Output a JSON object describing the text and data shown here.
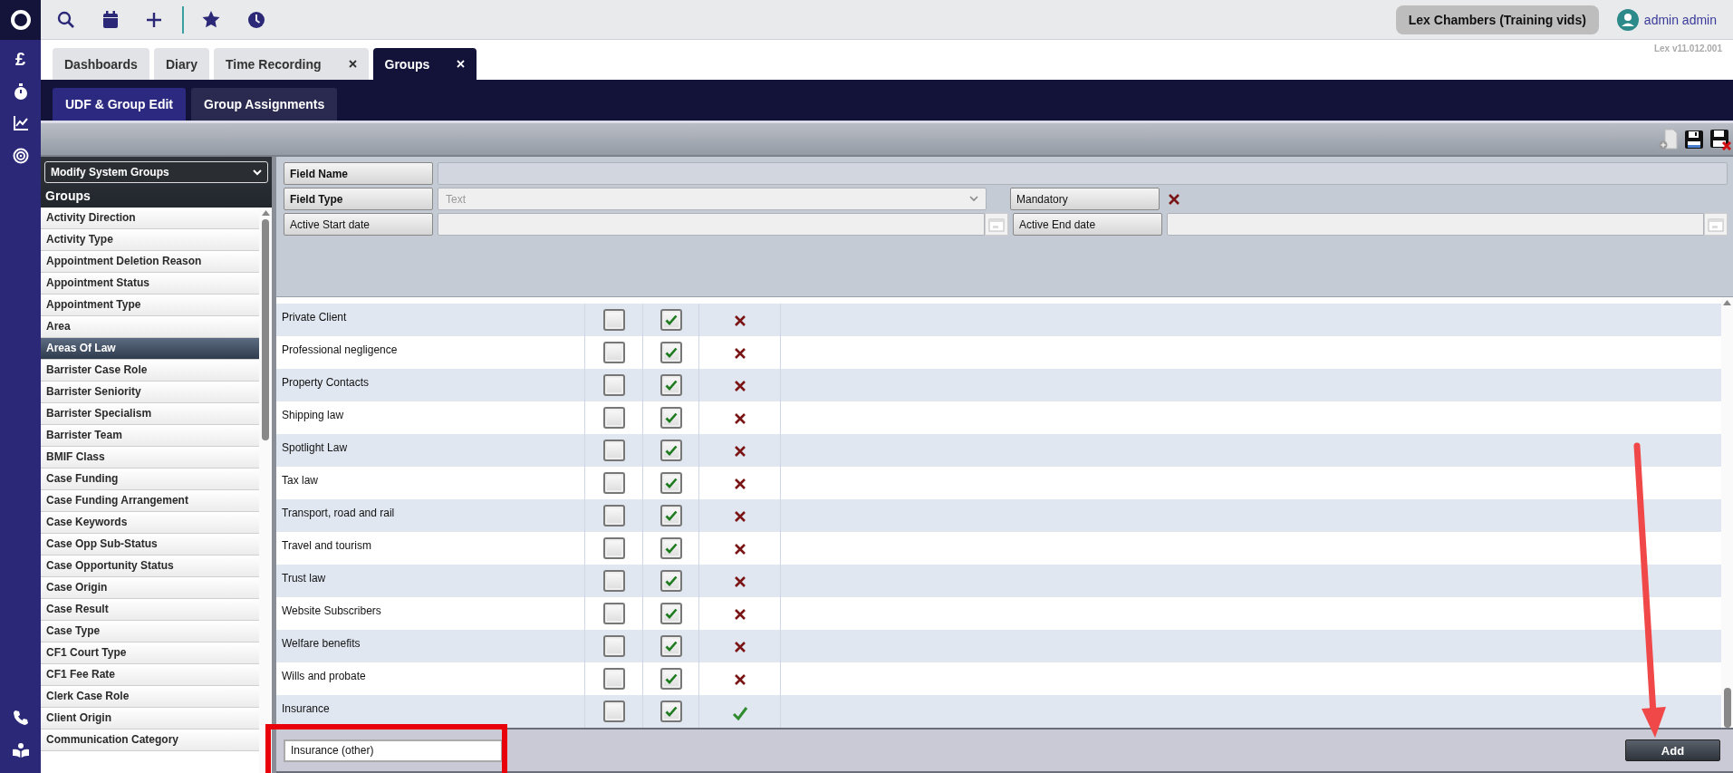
{
  "rail": {
    "currency_glyph": "£"
  },
  "topbar": {
    "company": "Lex Chambers (Training vids)",
    "user": "admin admin",
    "version": "Lex v11.012.001"
  },
  "tabs": [
    {
      "label": "Dashboards",
      "selected": false,
      "closable": false
    },
    {
      "label": "Diary",
      "selected": false,
      "closable": false
    },
    {
      "label": "Time Recording",
      "selected": false,
      "closable": true
    },
    {
      "label": "Groups",
      "selected": true,
      "closable": true
    }
  ],
  "subtabs": [
    {
      "label": "UDF & Group Edit",
      "selected": true
    },
    {
      "label": "Group Assignments",
      "selected": false
    }
  ],
  "group_selector": {
    "value": "Modify System Groups"
  },
  "groups": {
    "title": "Groups",
    "items": [
      {
        "label": "Activity Direction",
        "selected": false
      },
      {
        "label": "Activity Type",
        "selected": false
      },
      {
        "label": "Appointment Deletion Reason",
        "selected": false
      },
      {
        "label": "Appointment Status",
        "selected": false
      },
      {
        "label": "Appointment Type",
        "selected": false
      },
      {
        "label": "Area",
        "selected": false
      },
      {
        "label": "Areas Of Law",
        "selected": true
      },
      {
        "label": "Barrister Case Role",
        "selected": false
      },
      {
        "label": "Barrister Seniority",
        "selected": false
      },
      {
        "label": "Barrister Specialism",
        "selected": false
      },
      {
        "label": "Barrister Team",
        "selected": false
      },
      {
        "label": "BMIF Class",
        "selected": false
      },
      {
        "label": "Case Funding",
        "selected": false
      },
      {
        "label": "Case Funding Arrangement",
        "selected": false
      },
      {
        "label": "Case Keywords",
        "selected": false
      },
      {
        "label": "Case Opp Sub-Status",
        "selected": false
      },
      {
        "label": "Case Opportunity Status",
        "selected": false
      },
      {
        "label": "Case Origin",
        "selected": false
      },
      {
        "label": "Case Result",
        "selected": false
      },
      {
        "label": "Case Type",
        "selected": false
      },
      {
        "label": "CF1 Court Type",
        "selected": false
      },
      {
        "label": "CF1 Fee Rate",
        "selected": false
      },
      {
        "label": "Clerk Case Role",
        "selected": false
      },
      {
        "label": "Client Origin",
        "selected": false
      },
      {
        "label": "Communication Category",
        "selected": false
      }
    ]
  },
  "form": {
    "field_name": {
      "label": "Field Name",
      "required": true
    },
    "field_type": {
      "label": "Field Type",
      "required": true,
      "value": "Text",
      "disabled": true
    },
    "mandatory": {
      "label": "Mandatory",
      "required": false,
      "checked": false
    },
    "active_start": {
      "label": "Active Start date",
      "required": false
    },
    "active_end": {
      "label": "Active End date",
      "required": false
    }
  },
  "values": {
    "rows": [
      {
        "name": "Private Client",
        "checkbox_1": false,
        "checkbox_2": true,
        "active": false
      },
      {
        "name": "Professional negligence",
        "checkbox_1": false,
        "checkbox_2": true,
        "active": false
      },
      {
        "name": "Property Contacts",
        "checkbox_1": false,
        "checkbox_2": true,
        "active": false
      },
      {
        "name": "Shipping law",
        "checkbox_1": false,
        "checkbox_2": true,
        "active": false
      },
      {
        "name": "Spotlight Law",
        "checkbox_1": false,
        "checkbox_2": true,
        "active": false
      },
      {
        "name": "Tax law",
        "checkbox_1": false,
        "checkbox_2": true,
        "active": false
      },
      {
        "name": "Transport, road and rail",
        "checkbox_1": false,
        "checkbox_2": true,
        "active": false
      },
      {
        "name": "Travel and tourism",
        "checkbox_1": false,
        "checkbox_2": true,
        "active": false
      },
      {
        "name": "Trust law",
        "checkbox_1": false,
        "checkbox_2": true,
        "active": false
      },
      {
        "name": "Website Subscribers",
        "checkbox_1": false,
        "checkbox_2": true,
        "active": false
      },
      {
        "name": "Welfare benefits",
        "checkbox_1": false,
        "checkbox_2": true,
        "active": false
      },
      {
        "name": "Wills and probate",
        "checkbox_1": false,
        "checkbox_2": true,
        "active": false
      },
      {
        "name": "Insurance",
        "checkbox_1": false,
        "checkbox_2": true,
        "active": true
      }
    ]
  },
  "new_value": {
    "value": "Insurance (other)"
  },
  "add_button": {
    "label": "Add"
  },
  "annotations": {
    "highlight_box": true,
    "arrow": true
  }
}
